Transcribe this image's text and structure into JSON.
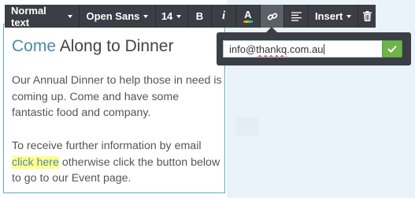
{
  "toolbar": {
    "format": "Normal text",
    "font": "Open Sans",
    "size": "14",
    "bold": "B",
    "italic": "i",
    "color_letter": "A",
    "insert": "Insert"
  },
  "link_popover": {
    "value_prefix": "info@",
    "value_misspelled": "thankq",
    "value_suffix": ".com.au"
  },
  "content": {
    "heading_accent": "Come",
    "heading_rest": " Along to Dinner",
    "para1": "Our Annual Dinner to help those in need is coming up. Come and have some fantastic food and company.",
    "para2_before": "To receive further information by email",
    "para2_link": "click here",
    "para2_after": " otherwise click the button below to go to our Event page."
  },
  "colors": {
    "accent": "#4f8aa5",
    "highlight": "#ffff8c",
    "toolbar_bg": "#3b3e44",
    "ok_green": "#6fb34b",
    "border": "#56b0c0"
  },
  "icons": [
    "link-icon",
    "align-left-icon",
    "trash-icon",
    "checkmark-icon",
    "caret-down-icon"
  ]
}
